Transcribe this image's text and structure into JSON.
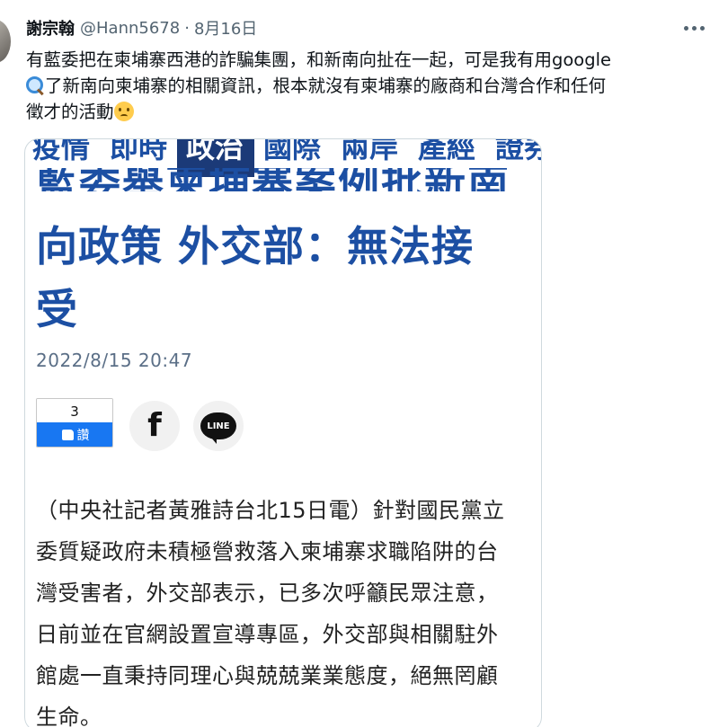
{
  "tweet": {
    "author_name": "謝宗翰",
    "handle": "@Hann5678",
    "separator": "·",
    "date": "8月16日",
    "text_lines": [
      "有藍委把在柬埔寨西港的詐騙集團，和新南向扯在一起，可是我有用google",
      "了新南向柬埔寨的相關資訊，根本就沒有柬埔寨的廠商和台灣合作和任何",
      "徵才的活動"
    ],
    "emoji": [
      "magnifying-glass-icon",
      "frowning-face-icon"
    ]
  },
  "article": {
    "nav_items": [
      "疫情",
      "即時",
      "政治",
      "國際",
      "兩岸",
      "產經",
      "證券"
    ],
    "nav_active": "政治",
    "headline_partial": "藍委舉柬埔寨案例批新南",
    "headline_lines": [
      "向政策 外交部：無法接",
      "受"
    ],
    "date": "2022/8/15 20:47",
    "like_count": "3",
    "like_label": "讚",
    "line_label": "LINE",
    "body_lines": [
      "（中央社記者黃雅詩台北15日電）針對國民黨立",
      "委質疑政府未積極營救落入柬埔寨求職陷阱的台",
      "灣受害者，外交部表示，已多次呼籲民眾注意，",
      "日前並在官網設置宣導專區，外交部與相關駐外",
      "館處一直秉持同理心與兢兢業業態度，絕無罔顧",
      "生命。"
    ]
  },
  "colors": {
    "headline_blue": "#1c4fa3",
    "nav_active_bg": "#1b3a78",
    "facebook_blue": "#1877f2",
    "secondary_text": "#536471"
  }
}
